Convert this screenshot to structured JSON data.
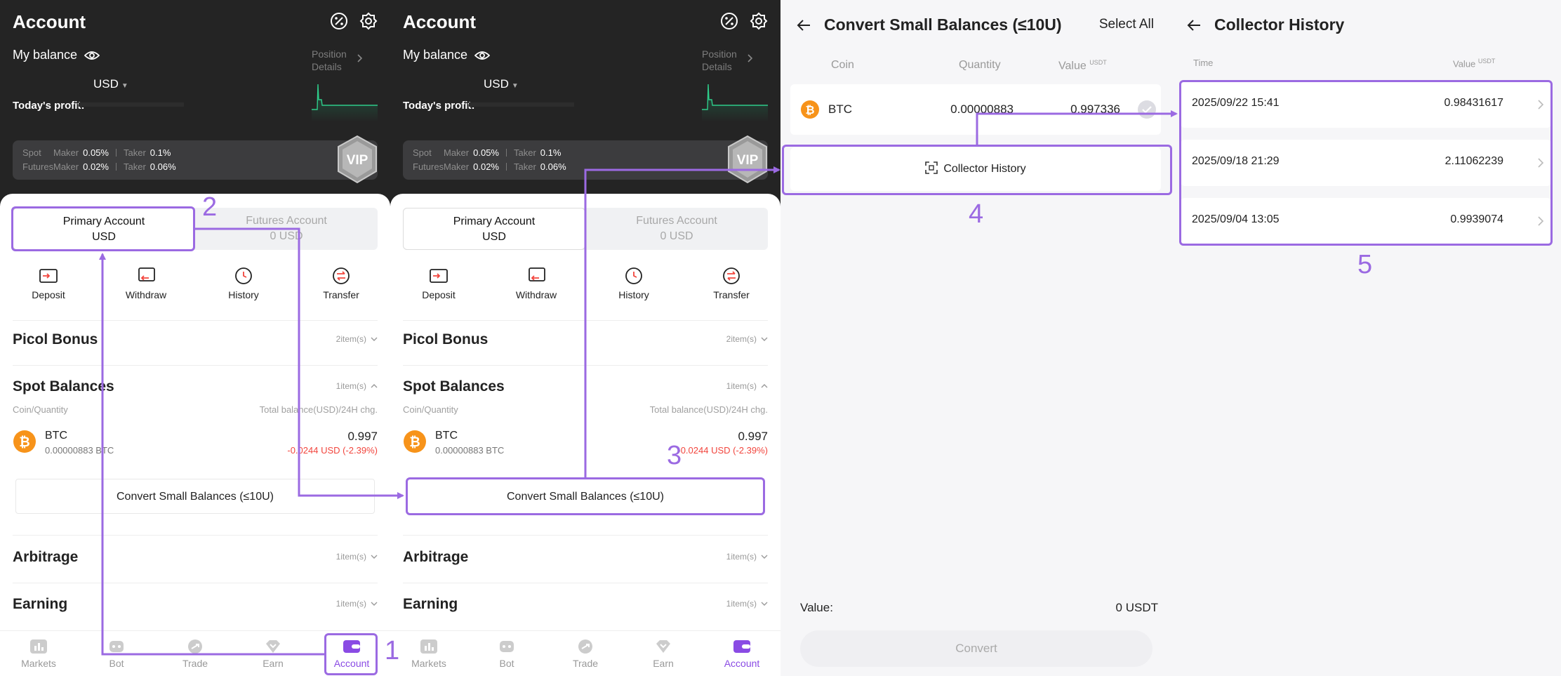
{
  "account_screen": {
    "title": "Account",
    "my_balance": "My balance",
    "position_details": "Position Details",
    "currency": "USD",
    "todays_profit": "Today's profit:",
    "fees": {
      "spot_label": "Spot",
      "futures_label": "Futures",
      "maker_label": "Maker",
      "taker_label": "Taker",
      "spot_maker": "0.05%",
      "spot_taker": "0.1%",
      "futures_maker": "0.02%",
      "futures_taker": "0.06%"
    },
    "vip_badge": "VIP",
    "primary_tab": {
      "name": "Primary Account",
      "value": "USD"
    },
    "futures_tab": {
      "name": "Futures Account",
      "value": "0 USD"
    },
    "actions": [
      {
        "label": "Deposit",
        "icon": "deposit-icon"
      },
      {
        "label": "Withdraw",
        "icon": "withdraw-icon"
      },
      {
        "label": "History",
        "icon": "clock-icon"
      },
      {
        "label": "Transfer",
        "icon": "transfer-icon"
      }
    ],
    "picol_bonus": {
      "title": "Picol Bonus",
      "count": "2item(s)"
    },
    "spot_balances": {
      "title": "Spot Balances",
      "count": "1item(s)",
      "col_left": "Coin/Quantity",
      "col_right": "Total balance(USD)/24H chg.",
      "coin": "BTC",
      "quantity": "0.00000883 BTC",
      "value": "0.997",
      "change": "-0.0244 USD (-2.39%)"
    },
    "convert_button": "Convert Small Balances (≤10U)",
    "arbitrage": {
      "title": "Arbitrage",
      "count": "1item(s)"
    },
    "earning": {
      "title": "Earning",
      "count": "1item(s)"
    },
    "nav": [
      {
        "label": "Markets",
        "icon": "markets-icon"
      },
      {
        "label": "Bot",
        "icon": "bot-icon"
      },
      {
        "label": "Trade",
        "icon": "trade-icon"
      },
      {
        "label": "Earn",
        "icon": "earn-icon"
      },
      {
        "label": "Account",
        "icon": "wallet-icon"
      }
    ]
  },
  "convert_screen": {
    "title": "Convert Small Balances (≤10U)",
    "select_all": "Select All",
    "col_coin": "Coin",
    "col_quantity": "Quantity",
    "col_value": "Value",
    "col_value_unit": "USDT",
    "coin": "BTC",
    "quantity": "0.00000883",
    "value": "0.997336",
    "collector_history": "Collector History",
    "value_label": "Value:",
    "value_total": "0 USDT",
    "convert": "Convert"
  },
  "history_screen": {
    "title": "Collector History",
    "col_time": "Time",
    "col_value": "Value",
    "col_value_unit": "USDT",
    "rows": [
      {
        "time": "2025/09/22 15:41",
        "value": "0.98431617"
      },
      {
        "time": "2025/09/18 21:29",
        "value": "2.11062239"
      },
      {
        "time": "2025/09/04 13:05",
        "value": "0.9939074"
      }
    ]
  },
  "annotations": {
    "step1": "1",
    "step2": "2",
    "step3": "3",
    "step4": "4",
    "step5": "5",
    "color": "#9b6ae2"
  },
  "colors": {
    "accent": "#8a4be4",
    "negative": "#f2453d",
    "header_bg": "#242424",
    "btc": "#f7931a"
  }
}
